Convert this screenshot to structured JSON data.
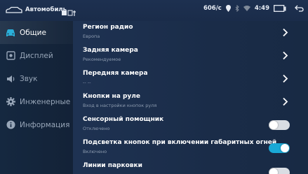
{
  "status_bar": {
    "app_title": "Автомобиль",
    "speed": "606/с",
    "time": "4:49"
  },
  "sidebar": {
    "items": [
      {
        "label": "Общие",
        "icon": "car-icon",
        "active": true
      },
      {
        "label": "Дисплей",
        "icon": "display-icon",
        "active": false
      },
      {
        "label": "Звук",
        "icon": "speaker-icon",
        "active": false
      },
      {
        "label": "Инженерные",
        "icon": "gear-icon",
        "active": false
      },
      {
        "label": "Информация",
        "icon": "info-icon",
        "active": false
      }
    ]
  },
  "settings": {
    "rows": [
      {
        "title": "Регион радио",
        "subtitle": "Европа",
        "control": "chevron"
      },
      {
        "title": "Задняя камера",
        "subtitle": "Рекомендуемое",
        "control": "chevron"
      },
      {
        "title": "Передняя камера",
        "subtitle": "-- --",
        "control": "chevron"
      },
      {
        "title": "Кнопки на руле",
        "subtitle": "Вход в настройки кнопок руля",
        "control": "chevron"
      },
      {
        "title": "Сенсорный помощник",
        "subtitle": "Отключено",
        "control": "toggle",
        "on": false
      },
      {
        "title": "Подсветка кнопок при включении габаритных огней",
        "subtitle": "Включено",
        "control": "toggle",
        "on": true
      },
      {
        "title": "Линии парковки",
        "subtitle": "",
        "control": "toggle",
        "on": false
      }
    ]
  },
  "colors": {
    "accent": "#1aa9d6",
    "background": "#14233b"
  }
}
